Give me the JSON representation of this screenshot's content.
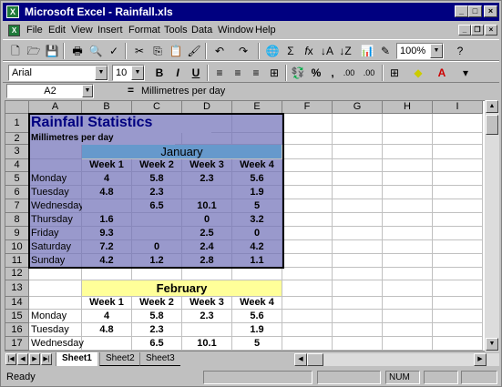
{
  "window": {
    "title": "Microsoft Excel - Rainfall.xls",
    "app_icon": "X"
  },
  "menubar": {
    "items": [
      "File",
      "Edit",
      "View",
      "Insert",
      "Format",
      "Tools",
      "Data",
      "Window",
      "Help"
    ]
  },
  "toolbar": {
    "zoom": "100%",
    "font": "Arial",
    "font_size": "10",
    "bold": "B",
    "italic": "I",
    "underline": "U",
    "percent": "%",
    "comma": ",",
    "inc_decimal": ".00",
    "dec_decimal": ".00"
  },
  "formula_bar": {
    "name_box": "A2",
    "equals": "=",
    "content": "Millimetres per day"
  },
  "grid": {
    "columns": [
      "A",
      "B",
      "C",
      "D",
      "E",
      "F",
      "G",
      "H",
      "I"
    ],
    "rows": [
      "1",
      "2",
      "3",
      "4",
      "5",
      "6",
      "7",
      "8",
      "9",
      "10",
      "11",
      "12",
      "13",
      "14",
      "15",
      "16",
      "17"
    ],
    "title": "Rainfall Statistics",
    "subtitle": "Millimetres per day",
    "january": {
      "month": "January",
      "weeks": [
        "Week 1",
        "Week 2",
        "Week 3",
        "Week 4"
      ],
      "rows": [
        {
          "day": "Monday",
          "values": [
            "4",
            "5.8",
            "2.3",
            "5.6"
          ]
        },
        {
          "day": "Tuesday",
          "values": [
            "4.8",
            "2.3",
            "",
            "1.9"
          ]
        },
        {
          "day": "Wednesday",
          "values": [
            "",
            "6.5",
            "10.1",
            "5"
          ]
        },
        {
          "day": "Thursday",
          "values": [
            "1.6",
            "",
            "0",
            "3.2"
          ]
        },
        {
          "day": "Friday",
          "values": [
            "9.3",
            "",
            "2.5",
            "0"
          ]
        },
        {
          "day": "Saturday",
          "values": [
            "7.2",
            "0",
            "2.4",
            "4.2"
          ]
        },
        {
          "day": "Sunday",
          "values": [
            "4.2",
            "1.2",
            "2.8",
            "1.1"
          ]
        }
      ]
    },
    "february": {
      "month": "February",
      "weeks": [
        "Week 1",
        "Week 2",
        "Week 3",
        "Week 4"
      ],
      "rows": [
        {
          "day": "Monday",
          "values": [
            "4",
            "5.8",
            "2.3",
            "5.6"
          ]
        },
        {
          "day": "Tuesday",
          "values": [
            "4.8",
            "2.3",
            "",
            "1.9"
          ]
        },
        {
          "day": "Wednesday",
          "values": [
            "",
            "6.5",
            "10.1",
            "5"
          ]
        }
      ]
    }
  },
  "sheets": [
    "Sheet1",
    "Sheet2",
    "Sheet3"
  ],
  "active_sheet": "Sheet1",
  "status": {
    "text": "Ready",
    "num": "NUM"
  },
  "colors": {
    "title_bar": "#000080",
    "table_purple": "#9999cc",
    "header_blue": "#6699cc",
    "header_yellow": "#ffff99"
  }
}
